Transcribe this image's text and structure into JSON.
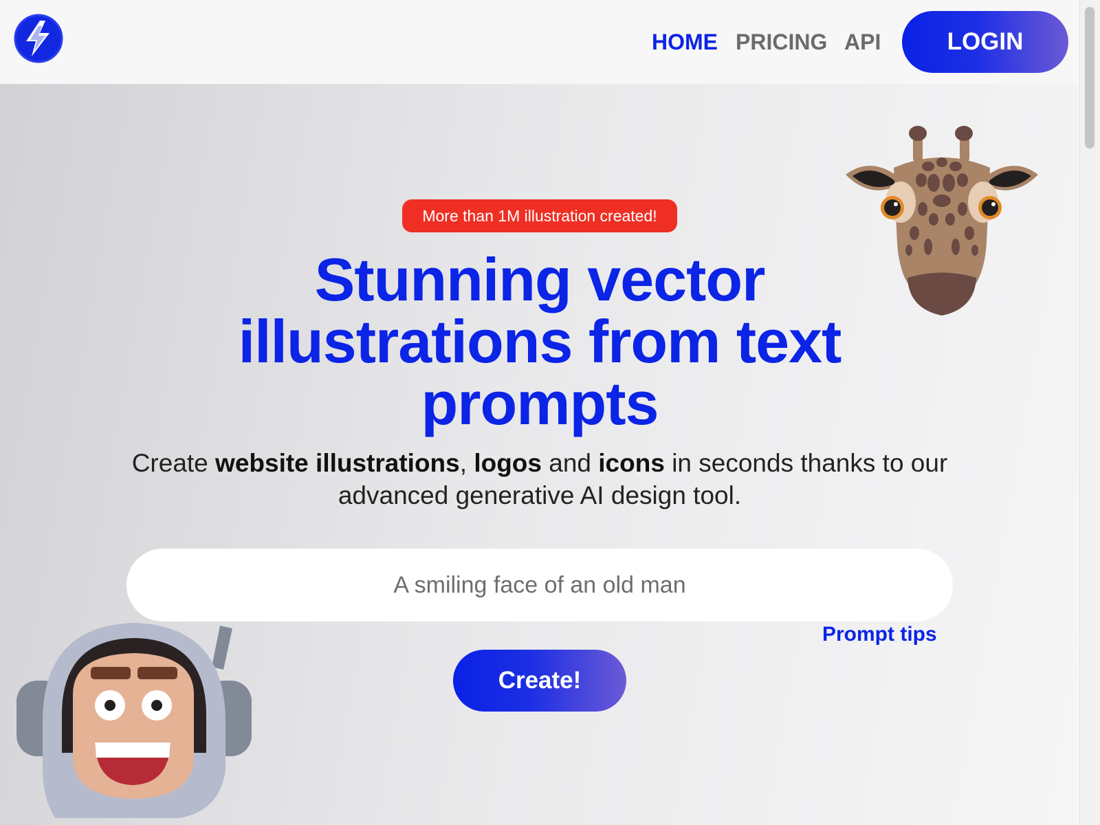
{
  "header": {
    "nav": [
      {
        "label": "HOME",
        "active": true
      },
      {
        "label": "PRICING",
        "active": false
      },
      {
        "label": "API",
        "active": false
      }
    ],
    "login_label": "LOGIN"
  },
  "hero": {
    "badge": "More than 1M illustration created!",
    "headline": "Stunning vector illustrations from text prompts",
    "subline": {
      "t1": "Create ",
      "b1": "website illustrations",
      "t2": ", ",
      "b2": "logos",
      "t3": " and ",
      "b3": "icons",
      "t4": " in seconds thanks to our advanced generative AI design tool."
    },
    "prompt_placeholder": "A smiling face of an old man",
    "prompt_tips": "Prompt tips",
    "create_label": "Create!"
  },
  "colors": {
    "accent": "#0b24e6",
    "badge": "#ef2f24",
    "gradient_end": "#6b5ad6"
  },
  "icons": {
    "logo": "lightning-bolt-logo-icon",
    "decor_right": "giraffe-illustration",
    "decor_left": "astronaut-illustration"
  }
}
